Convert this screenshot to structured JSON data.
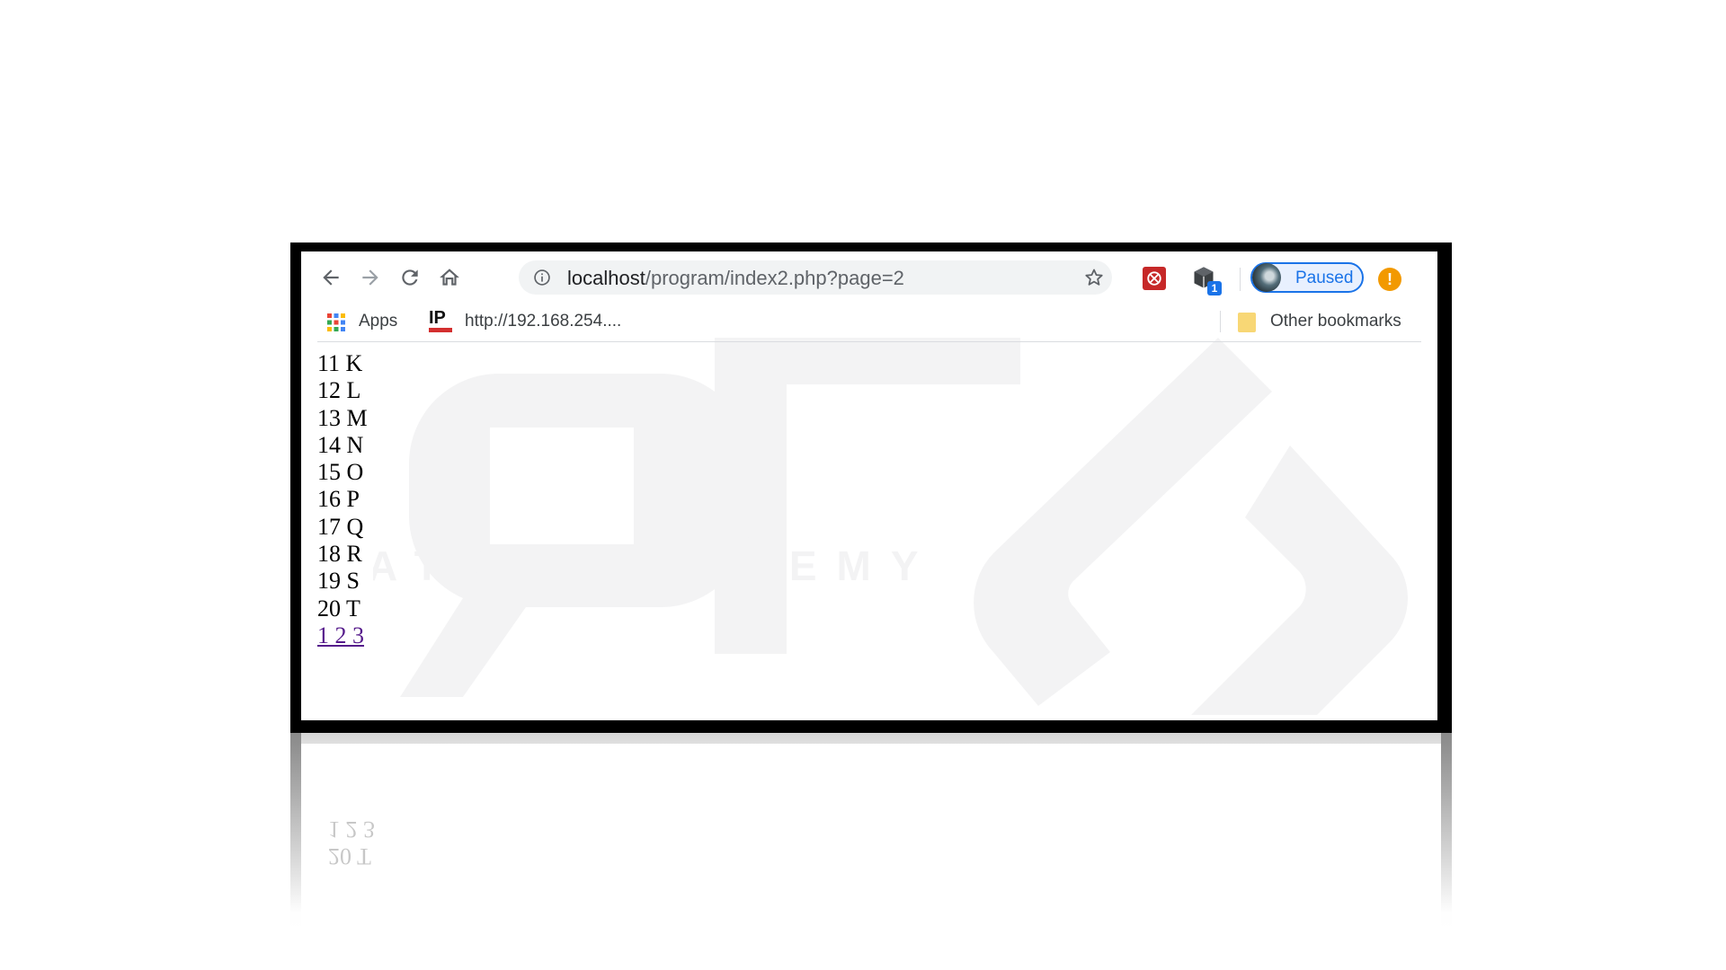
{
  "toolbar": {
    "url_host": "localhost",
    "url_path": "/program/index2.php?page=2",
    "profile_label": "Paused",
    "alert_glyph": "!",
    "extension_badge": "1"
  },
  "bookmarks": {
    "apps_label": "Apps",
    "ip_icon_text": "IP",
    "ip_bookmark_label": "http://192.168.254....",
    "other_label": "Other bookmarks"
  },
  "content": {
    "rows": [
      "11 K",
      "12 L",
      "13 M",
      "14 N",
      "15 O",
      "16 P",
      "17 Q",
      "18 R",
      "19 S",
      "20 T"
    ],
    "pages": [
      "1",
      "2",
      "3"
    ]
  },
  "watermark": {
    "text": "ATRO ACADEMY"
  },
  "reflection": {
    "lines": [
      "1 2 3",
      "20 T"
    ]
  },
  "colors": {
    "accent": "#1a73e8",
    "link_visited": "#551a8b",
    "alert": "#f29900",
    "extension_red": "#c62828"
  },
  "icons": [
    "back-arrow-icon",
    "forward-arrow-icon",
    "reload-icon",
    "home-icon",
    "info-icon",
    "star-icon",
    "apps-grid-icon",
    "folder-icon"
  ]
}
